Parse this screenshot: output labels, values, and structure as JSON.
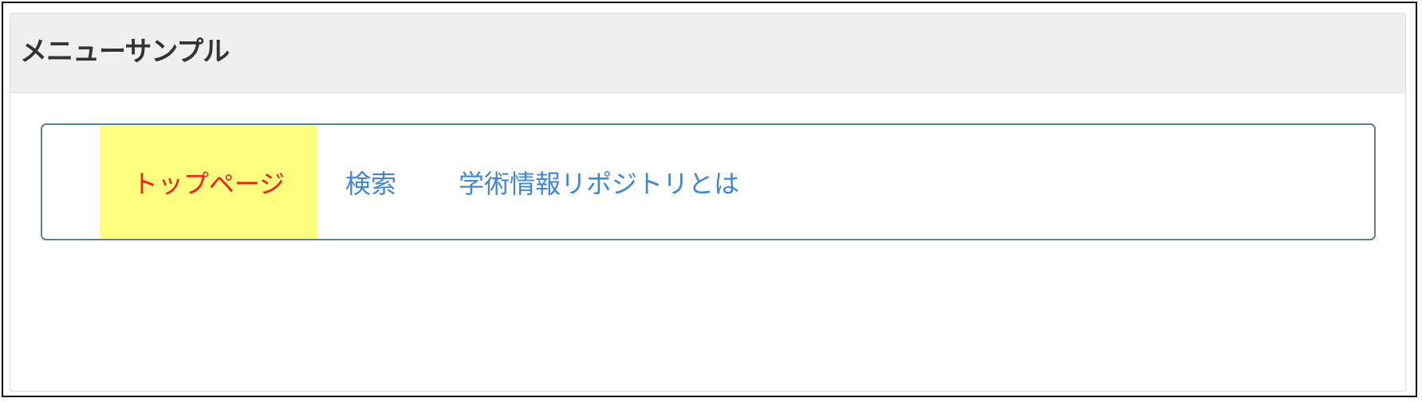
{
  "panel": {
    "title": "メニューサンプル"
  },
  "menu": {
    "items": [
      {
        "label": "トップページ",
        "active": true
      },
      {
        "label": "検索",
        "active": false
      },
      {
        "label": "学術情報リポジトリとは",
        "active": false
      }
    ]
  },
  "colors": {
    "active_background": "#ffff80",
    "active_text": "#ff1a1a",
    "link_text": "#3d87d8",
    "menu_border": "#5f7d95",
    "header_background": "#efefef"
  }
}
